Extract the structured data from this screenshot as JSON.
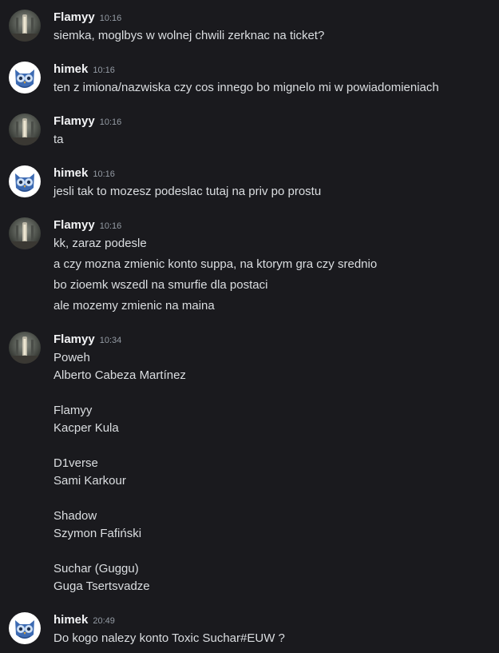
{
  "messages": [
    {
      "author": "Flamyy",
      "time": "10:16",
      "avatar": "flamyy-avatar",
      "lines": [
        "siemka, moglbys w wolnej chwili zerknac na ticket?"
      ]
    },
    {
      "author": "himek",
      "time": "10:16",
      "avatar": "owl-avatar",
      "lines": [
        "ten z imiona/nazwiska czy cos innego bo mignelo mi w powiadomieniach"
      ]
    },
    {
      "author": "Flamyy",
      "time": "10:16",
      "avatar": "flamyy-avatar",
      "lines": [
        "ta"
      ]
    },
    {
      "author": "himek",
      "time": "10:16",
      "avatar": "owl-avatar",
      "lines": [
        "jesli tak to mozesz podeslac tutaj na priv po prostu"
      ]
    },
    {
      "author": "Flamyy",
      "time": "10:16",
      "avatar": "flamyy-avatar",
      "lines": [
        "kk, zaraz podesle",
        "a czy mozna zmienic konto suppa, na ktorym gra czy srednio",
        "bo zioemk wszedl na smurfie dla postaci",
        "ale mozemy zmienic na maina"
      ]
    },
    {
      "author": "Flamyy",
      "time": "10:34",
      "avatar": "flamyy-avatar",
      "lines": [
        "Poweh",
        "Alberto Cabeza Martínez",
        "",
        "Flamyy",
        "Kacper Kula",
        "",
        "D1verse",
        "Sami Karkour",
        "",
        "Shadow",
        "Szymon Fafiński",
        "",
        "Suchar (Guggu)",
        "Guga Tsertsvadze"
      ]
    },
    {
      "author": "himek",
      "time": "20:49",
      "avatar": "owl-avatar",
      "lines": [
        "Do kogo nalezy konto Toxic Suchar#EUW ?"
      ]
    }
  ],
  "colors": {
    "background": "#1a1a1e",
    "username": "#f2f3f5",
    "timestamp": "#949ba4",
    "text": "#dbdee1",
    "owl_bg": "#ffffff",
    "owl_body": "#3d6bb3"
  }
}
